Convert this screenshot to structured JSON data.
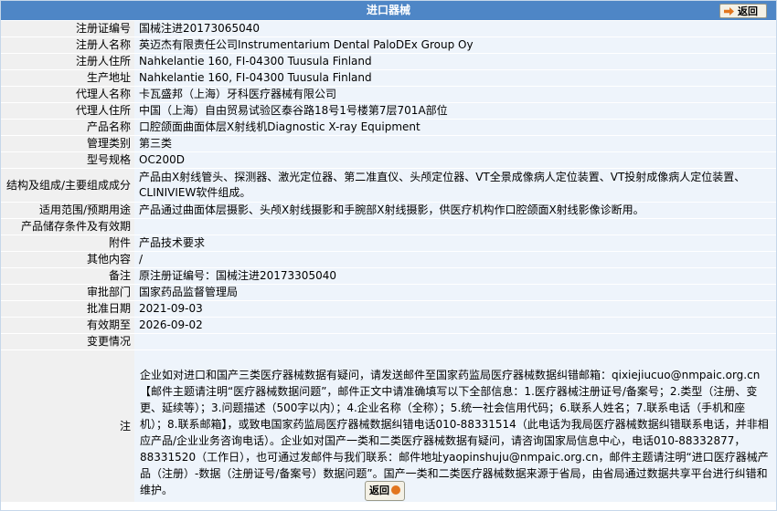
{
  "window": {
    "title": "进口器械",
    "back_label": "返回"
  },
  "rows": [
    {
      "label": "注册证编号",
      "value": "国械注进20173065040"
    },
    {
      "label": "注册人名称",
      "value": "英迈杰有限责任公司Instrumentarium Dental PaloDEx Group Oy"
    },
    {
      "label": "注册人住所",
      "value": "Nahkelantie 160, FI-04300 Tuusula Finland"
    },
    {
      "label": "生产地址",
      "value": "Nahkelantie 160, FI-04300 Tuusula Finland"
    },
    {
      "label": "代理人名称",
      "value": "卡瓦盛邦（上海）牙科医疗器械有限公司"
    },
    {
      "label": "代理人住所",
      "value": "中国（上海）自由贸易试验区泰谷路18号1号楼第7层701A部位"
    },
    {
      "label": "产品名称",
      "value": "口腔颌面曲面体层X射线机Diagnostic X-ray Equipment"
    },
    {
      "label": "管理类别",
      "value": "第三类"
    },
    {
      "label": "型号规格",
      "value": "OC200D"
    },
    {
      "label": "结构及组成/主要组成成分",
      "value": "产品由X射线管头、探测器、激光定位器、第二准直仪、头颅定位器、VT全景成像病人定位装置、VT投射成像病人定位装置、CLINIVIEW软件组成。"
    },
    {
      "label": "适用范围/预期用途",
      "value": "产品通过曲面体层摄影、头颅X射线摄影和手腕部X射线摄影，供医疗机构作口腔颌面X射线影像诊断用。"
    },
    {
      "label": "产品储存条件及有效期",
      "value": ""
    },
    {
      "label": "附件",
      "value": "产品技术要求"
    },
    {
      "label": "其他内容",
      "value": "/"
    },
    {
      "label": "备注",
      "value": "原注册证编号：国械注进20173305040"
    },
    {
      "label": "审批部门",
      "value": "国家药品监督管理局"
    },
    {
      "label": "批准日期",
      "value": "2021-09-03"
    },
    {
      "label": "有效期至",
      "value": "2026-09-02"
    },
    {
      "label": "变更情况",
      "value": ""
    }
  ],
  "note": {
    "label": "注",
    "text": "企业如对进口和国产三类医疗器械数据有疑问，请发送邮件至国家药监局医疗器械数据纠错邮箱：qixiejiucuo@nmpaic.org.cn【邮件主题请注明“医疗器械数据问题”，邮件正文中请准确填写以下全部信息：1.医疗器械注册证号/备案号；2.类型（注册、变更、延续等）；3.问题描述（500字以内）；4.企业名称（全称）；5.统一社会信用代码；6.联系人姓名；7.联系电话（手机和座机）；8.联系邮箱】，或致电国家药监局医疗器械数据纠错电话010-88331514（此电话为我局医疗器械数据纠错联系电话，并非相应产品/企业业务咨询电话）。企业如对国产一类和二类医疗器械数据有疑问，请咨询国家局信息中心，电话010-88332877，88331520（工作日），也可通过发邮件与我们联系：邮件地址yaopinshuju@nmpaic.org.cn，邮件主题请注明“进口医疗器械产品（注册）-数据（注册证号/备案号）数据问题”。国产一类和二类医疗器械数据来源于省局，由省局通过数据共享平台进行纠错和维护。"
  }
}
